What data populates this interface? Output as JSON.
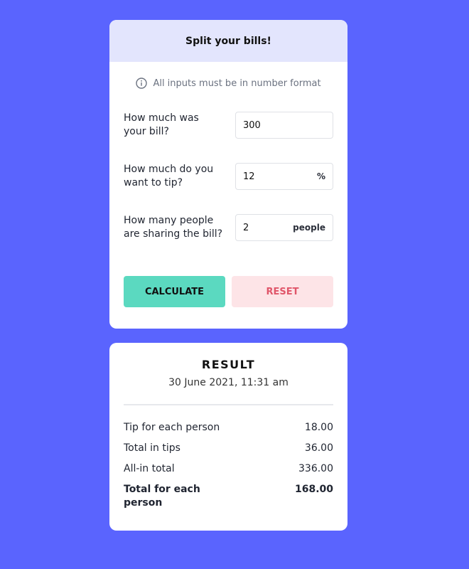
{
  "form": {
    "title": "Split your bills!",
    "hint": "All inputs must be in number format",
    "fields": [
      {
        "label": "How much was your bill?",
        "value": "300",
        "suffix": ""
      },
      {
        "label": "How much do you want to tip?",
        "value": "12",
        "suffix": "%"
      },
      {
        "label": "How many people are sharing the bill?",
        "value": "2",
        "suffix": "people"
      }
    ],
    "calculate_label": "CALCULATE",
    "reset_label": "RESET"
  },
  "result": {
    "title": "RESULT",
    "date": "30 June 2021, 11:31 am",
    "rows": [
      {
        "label": "Tip for each person",
        "value": "18.00"
      },
      {
        "label": "Total in tips",
        "value": "36.00"
      },
      {
        "label": "All-in total",
        "value": "336.00"
      },
      {
        "label": "Total for each person",
        "value": "168.00"
      }
    ]
  },
  "colors": {
    "background": "#5a64fe",
    "header": "#e3e5fd",
    "calculate": "#5bd9c0",
    "reset_bg": "#fde4e7",
    "reset_text": "#e0566a"
  },
  "icons": {
    "hint": "info-icon"
  }
}
